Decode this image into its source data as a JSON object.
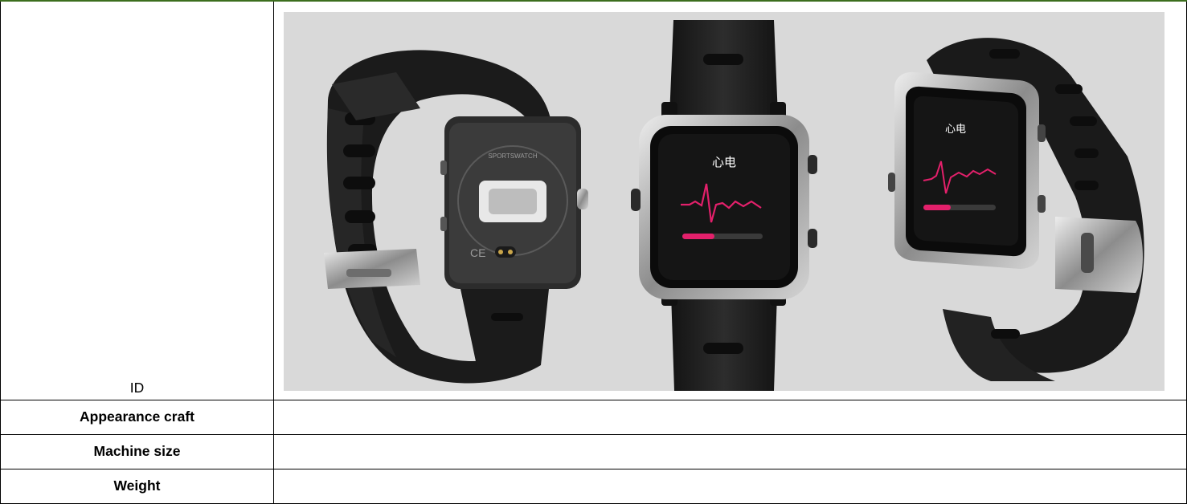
{
  "table": {
    "header_label": "ID",
    "rows": [
      {
        "label": "Appearance craft",
        "value": ""
      },
      {
        "label": "Machine size",
        "value": ""
      },
      {
        "label": "Weight",
        "value": ""
      }
    ]
  },
  "product_image": {
    "watches": [
      {
        "view": "back",
        "case_text": "SPORTSWATCH",
        "marking": "CE"
      },
      {
        "view": "front",
        "screen_title": "心电"
      },
      {
        "view": "angled",
        "screen_title": "心电"
      }
    ],
    "colors": {
      "background": "#d9d9d9",
      "strap": "#1e1e1e",
      "accent": "#e3206b",
      "bezel": "#a6a6a6"
    }
  }
}
